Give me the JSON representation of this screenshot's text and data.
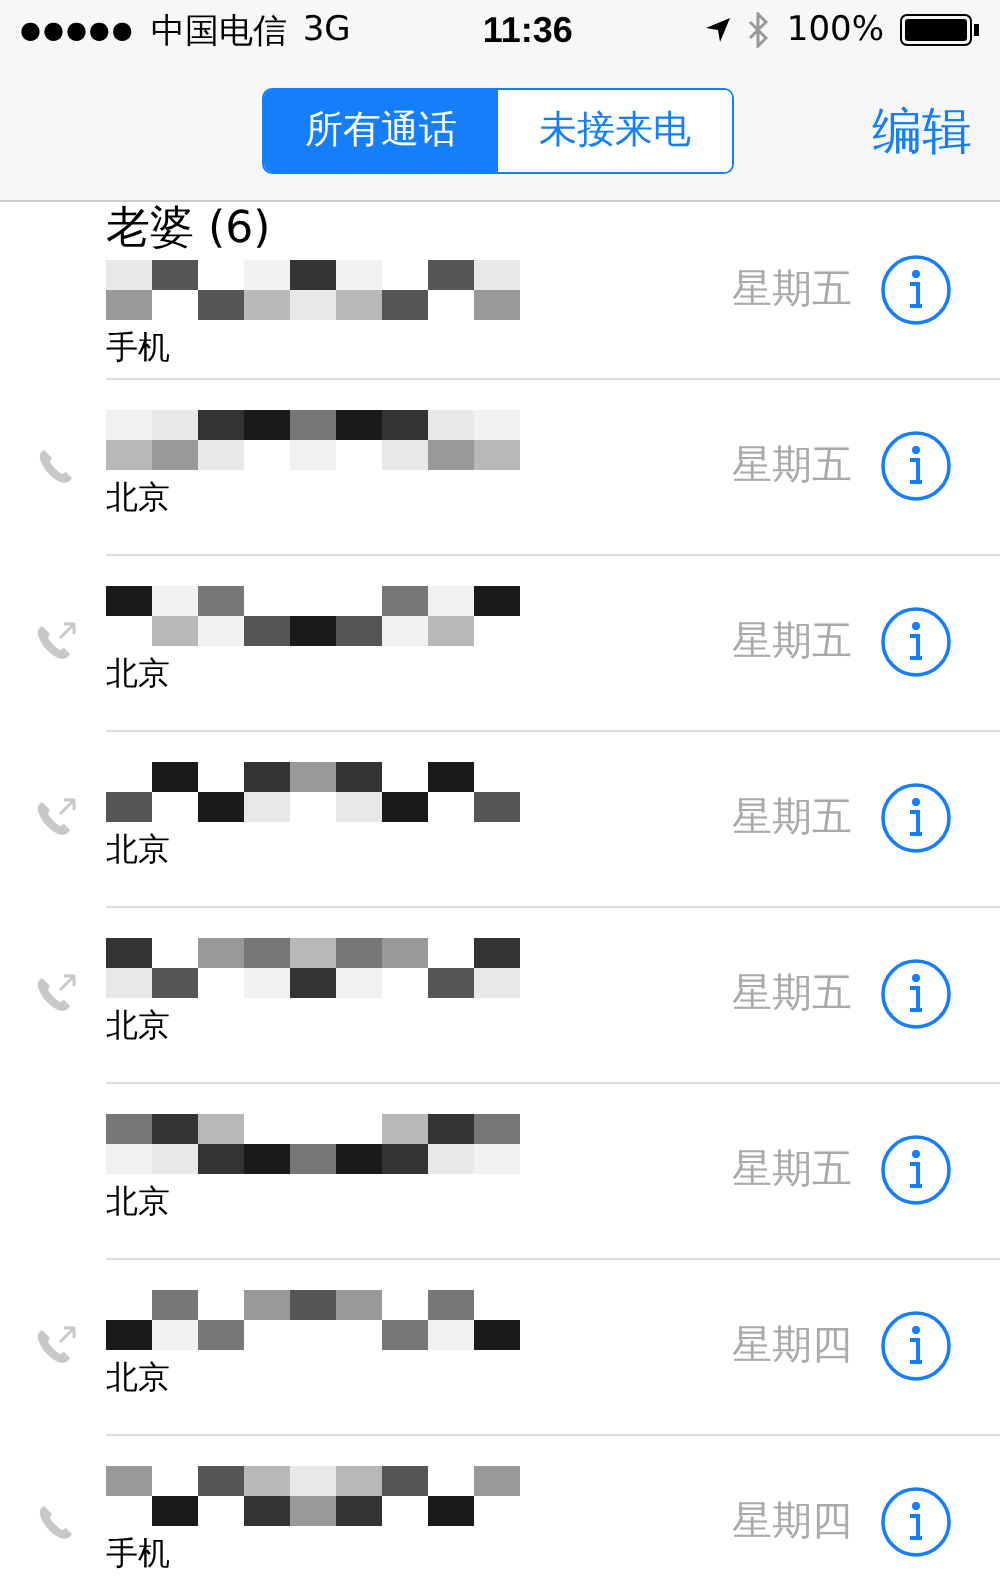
{
  "status_bar": {
    "signal_dots": "●●●●●",
    "carrier": "中国电信",
    "network": "3G",
    "time": "11:36",
    "battery": "100%"
  },
  "segments": [
    {
      "label": "所有通话",
      "selected": true
    },
    {
      "label": "未接来电",
      "selected": false
    }
  ],
  "edit_button": "编辑",
  "calls": [
    {
      "name": "老婆 (6)",
      "label": "手机",
      "day": "星期五",
      "kind": "incoming"
    },
    {
      "label": "北京",
      "day": "星期五",
      "kind": "call"
    },
    {
      "label": "北京",
      "day": "星期五",
      "kind": "outgoing"
    },
    {
      "label": "北京",
      "day": "星期五",
      "kind": "outgoing"
    },
    {
      "label": "北京",
      "day": "星期五",
      "kind": "outgoing"
    },
    {
      "label": "北京",
      "day": "星期五",
      "kind": "incoming"
    },
    {
      "label": "北京",
      "day": "星期四",
      "kind": "outgoing"
    },
    {
      "label": "手机",
      "day": "星期四",
      "kind": "call"
    }
  ]
}
